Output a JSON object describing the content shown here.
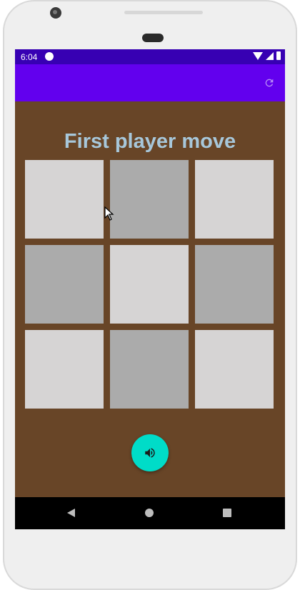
{
  "status_bar": {
    "time": "6:04"
  },
  "game": {
    "title": "First player move",
    "cells": [
      "",
      "",
      "",
      "",
      "",
      "",
      "",
      "",
      ""
    ]
  },
  "colors": {
    "status_bar": "#3700b3",
    "app_bar": "#6200ee",
    "background": "#684527",
    "title": "#a7c7da",
    "cell_light": "#d6d4d4",
    "cell_dark": "#ababab",
    "fab": "#00dcc8"
  },
  "icons": {
    "refresh": "refresh-icon",
    "sound": "volume-icon",
    "back": "back-icon",
    "home": "home-icon",
    "recents": "recents-icon"
  }
}
